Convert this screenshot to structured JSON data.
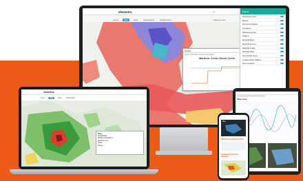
{
  "brand": {
    "logo_text": "elements.",
    "accent": "#2f9fd8",
    "band_color": "#ee5a17",
    "panel_color": "#17a99a"
  },
  "monitor": {
    "tabs": [
      {
        "label": "Home",
        "active": false
      },
      {
        "label": "Map",
        "active": true
      },
      {
        "label": "Data",
        "active": false
      },
      {
        "label": "Dashboards",
        "active": false
      },
      {
        "label": "Notifications",
        "active": false
      }
    ],
    "user_menu": "Select a user",
    "panel": {
      "title": "Layers",
      "rows": [
        "Measurements",
        "Rivers",
        "Flood Inundation",
        "Locations",
        "Measurements",
        "Stages",
        "Rainfall Rate",
        "Rainfall Accum",
        "Rainfall Totals",
        "Rainfall Rate",
        "Flood Risk Zone",
        "Lowest Bank Station",
        "Geo-Location"
      ]
    },
    "popup": {
      "title": "Martinez Creek-Cibolo Creek",
      "header": "Details",
      "tabs": "Gauge  Hydrograph  Forecast  Photograph"
    }
  },
  "laptop": {
    "tabs": [
      {
        "label": "Home",
        "active": false
      },
      {
        "label": "Map",
        "active": true
      },
      {
        "label": "Data",
        "active": false
      },
      {
        "label": "Dashboards",
        "active": false
      }
    ],
    "card": {
      "title": "Rain",
      "lines": [
        "Rainfall Rate",
        "Rainfall Totals(24hrs)",
        "Rainfall Accum",
        "Radar",
        "Stages"
      ]
    }
  },
  "tablet": {
    "tabs": "Home  Map  Data  Dashboards  Notifications",
    "chart_title": "Water Level"
  },
  "phone": {
    "map_label": "Map",
    "title1": "NOAA Forecast Extraction",
    "title2": "Inundation Forecast Analysis"
  }
}
